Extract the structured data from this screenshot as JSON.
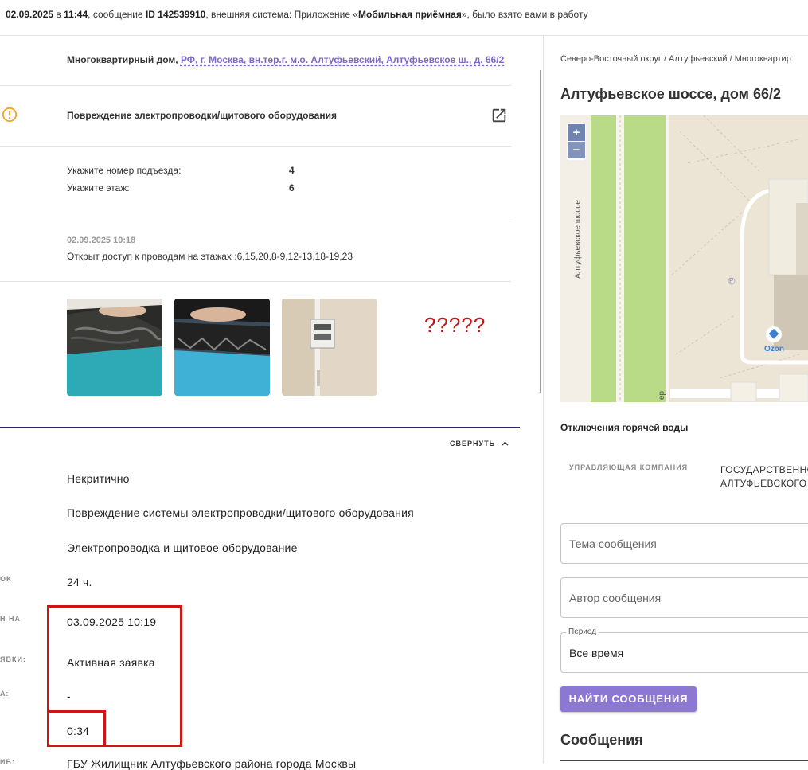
{
  "topbar": {
    "date": "02.09.2025",
    "in_word": "в",
    "time": "11:44",
    "msg_prefix": ", сообщение",
    "msg_id": "ID 142539910",
    "system_text": ", внешняя система: Приложение «",
    "app_name": "Мобильная приёмная",
    "suffix": "», было взято вами в работу"
  },
  "address": {
    "label": "Многоквартирный дом,",
    "link": "РФ, г. Москва, вн.тер.г. м.о. Алтуфьевский, Алтуфьевское ш., д. 66/2"
  },
  "issue": {
    "title": "Повреждение электропроводки/щитового оборудования"
  },
  "details": {
    "entrance_label": "Укажите номер подъезда:",
    "entrance_value": "4",
    "floor_label": "Укажите этаж:",
    "floor_value": "6"
  },
  "comment": {
    "date": "02.09.2025 10:18",
    "text": "Открыт доступ к проводам на этажах :6,15,20,8-9,12-13,18-19,23"
  },
  "photos": {
    "question_marks": "?????"
  },
  "collapse_label": "СВЕРНУТЬ",
  "info": {
    "labels": [
      "ОК",
      "Н НА",
      "ЯВКИ:",
      "А:",
      "ИВ:"
    ],
    "criticality": "Некритично",
    "problem": "Повреждение системы электропроводки/щитового оборудования",
    "category": "Электропроводка и щитовое оборудование",
    "deadline": "24 ч.",
    "due_date": "03.09.2025 10:19",
    "status": "Активная заявка",
    "dash": "-",
    "elapsed": "0:34",
    "org": "ГБУ Жилищник Алтуфьевского района города Москвы"
  },
  "right": {
    "breadcrumb": "Северо-Восточный округ / Алтуфьевский / Многоквартир",
    "building_title": "Алтуфьевское шоссе, дом 66/2",
    "map": {
      "zoom_in": "+",
      "zoom_out": "−",
      "street_label": "Алтуфьевское шоссе",
      "parking": "P",
      "poi": "Ozon",
      "edge_text": "ер"
    },
    "hot_water": "Отключения горячей воды",
    "mgmt_label": "УПРАВЛЯЮЩАЯ КОМПАНИЯ",
    "mgmt_value_1": "ГОСУДАРСТВЕННО",
    "mgmt_value_2": "АЛТУФЬЕВСКОГО Р",
    "topic_placeholder": "Тема сообщения",
    "author_placeholder": "Автор сообщения",
    "period_label": "Период",
    "period_value": "Все время",
    "find_button": "НАЙТИ СООБЩЕНИЯ",
    "messages_heading": "Сообщения"
  },
  "colors": {
    "accent": "#8c78d2",
    "link": "#7b68c8",
    "warning": "#f5a623",
    "highlight": "#d01414"
  }
}
